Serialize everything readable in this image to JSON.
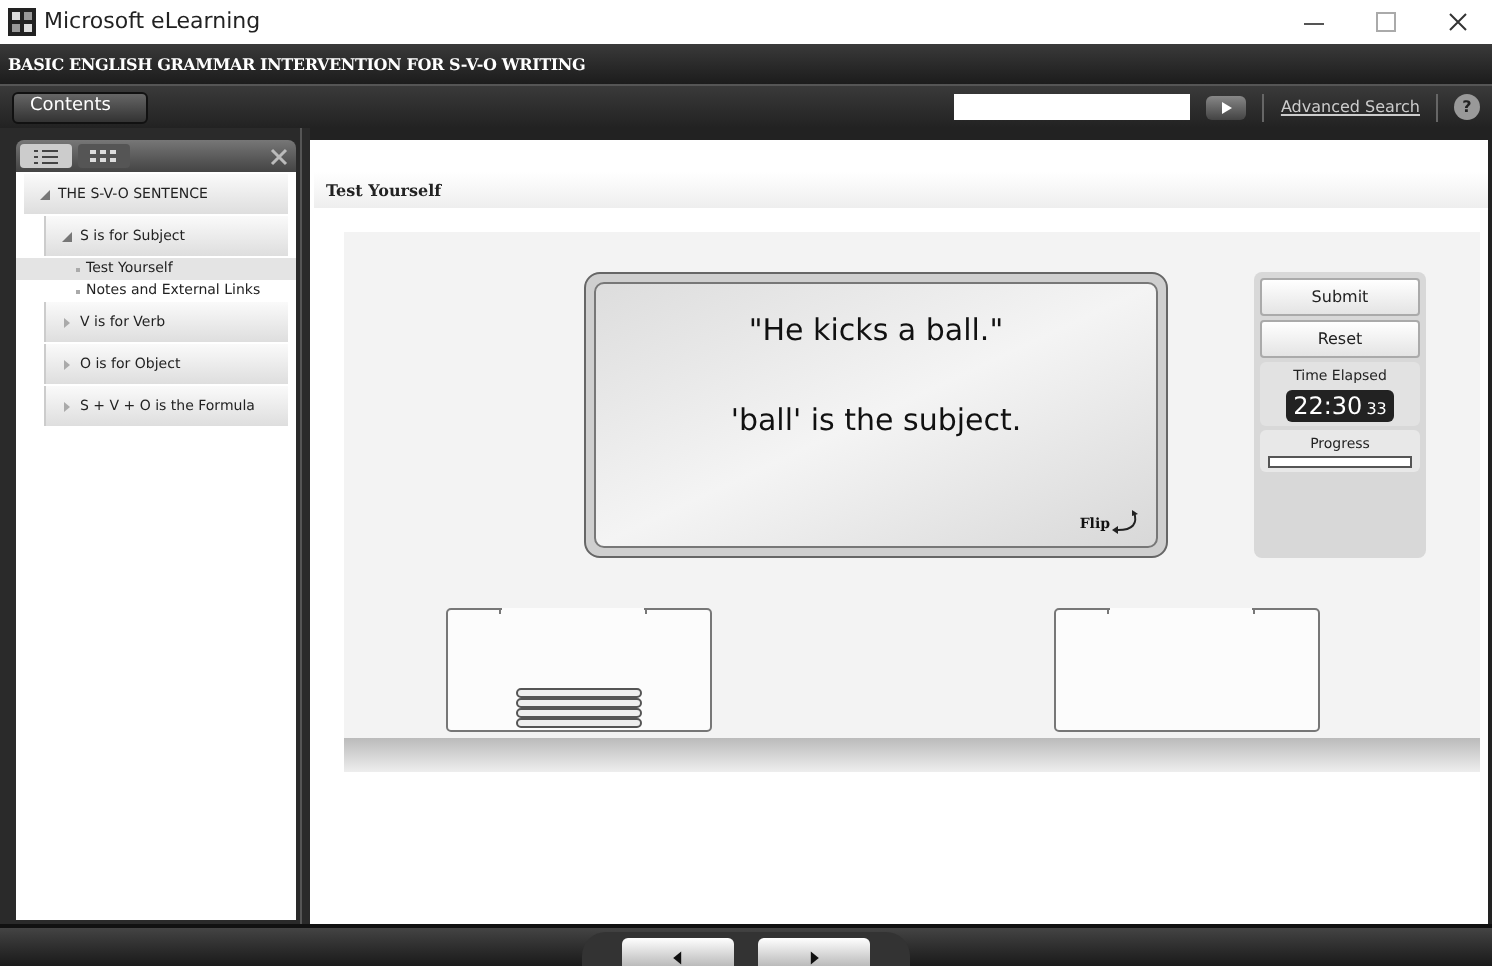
{
  "window": {
    "title": "Microsoft eLearning"
  },
  "course_title": "BASIC ENGLISH GRAMMAR INTERVENTION FOR S-V-O WRITING",
  "toolbar": {
    "contents_button": "Contents",
    "advanced_search": "Advanced Search",
    "help": "?"
  },
  "sidebar": {
    "view_tabs": [
      {
        "kind": "list",
        "selected": true
      },
      {
        "kind": "grid",
        "selected": false
      }
    ],
    "tree": [
      {
        "kind": "section",
        "label": "THE S-V-O SENTENCE",
        "expanded": true,
        "children": [
          {
            "kind": "topic",
            "label": "S is for Subject",
            "expanded": true,
            "children": [
              {
                "kind": "page",
                "label": "Test Yourself",
                "selected": true
              },
              {
                "kind": "page",
                "label": "Notes and External Links",
                "selected": false
              }
            ]
          },
          {
            "kind": "topic",
            "label": "V is for Verb",
            "expanded": false
          },
          {
            "kind": "topic",
            "label": "O is for Object",
            "expanded": false
          },
          {
            "kind": "topic",
            "label": "S + V + O is the Formula",
            "expanded": false
          }
        ]
      }
    ]
  },
  "page_title": "Test Yourself",
  "flashcard": {
    "sentence": "\"He kicks a ball.\"",
    "statement": "'ball' is the subject.",
    "flip": "Flip"
  },
  "controls": {
    "buttons": [
      "Submit",
      "Reset"
    ],
    "time_label": "Time Elapsed",
    "time": "22:30",
    "seconds": "33",
    "progress_label": "Progress",
    "progress": {
      "level": 0
    }
  },
  "drop_boxes": [
    {
      "has_cards": true
    },
    {
      "has_cards": false
    }
  ]
}
